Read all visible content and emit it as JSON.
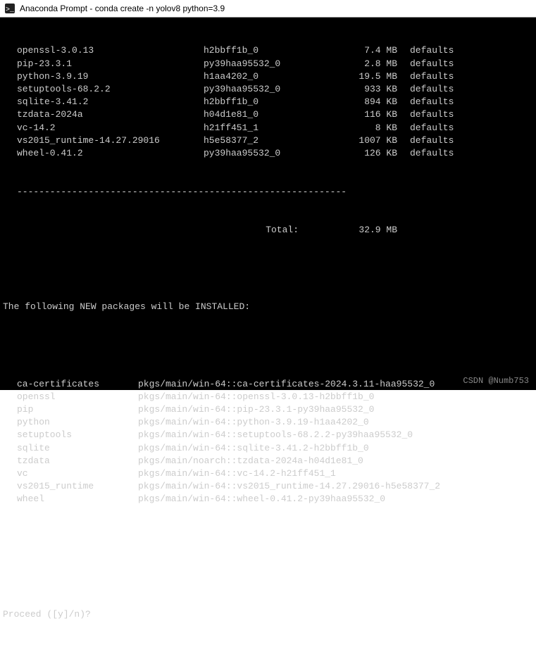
{
  "window": {
    "title": "Anaconda Prompt - conda  create -n yolov8 python=3.9"
  },
  "download_table": [
    {
      "name": "openssl-3.0.13",
      "build": "h2bbff1b_0",
      "size": "7.4 MB",
      "channel": "defaults"
    },
    {
      "name": "pip-23.3.1",
      "build": "py39haa95532_0",
      "size": "2.8 MB",
      "channel": "defaults"
    },
    {
      "name": "python-3.9.19",
      "build": "h1aa4202_0",
      "size": "19.5 MB",
      "channel": "defaults"
    },
    {
      "name": "setuptools-68.2.2",
      "build": "py39haa95532_0",
      "size": "933 KB",
      "channel": "defaults"
    },
    {
      "name": "sqlite-3.41.2",
      "build": "h2bbff1b_0",
      "size": "894 KB",
      "channel": "defaults"
    },
    {
      "name": "tzdata-2024a",
      "build": "h04d1e81_0",
      "size": "116 KB",
      "channel": "defaults"
    },
    {
      "name": "vc-14.2",
      "build": "h21ff451_1",
      "size": "8 KB",
      "channel": "defaults"
    },
    {
      "name": "vs2015_runtime-14.27.29016",
      "build": "h5e58377_2",
      "size": "1007 KB",
      "channel": "defaults"
    },
    {
      "name": "wheel-0.41.2",
      "build": "py39haa95532_0",
      "size": "126 KB",
      "channel": "defaults"
    }
  ],
  "separator": "------------------------------------------------------------",
  "total": {
    "label": "Total:",
    "value": "32.9 MB"
  },
  "install_heading": "The following NEW packages will be INSTALLED:",
  "install_list": [
    {
      "name": "ca-certificates",
      "spec": "pkgs/main/win-64::ca-certificates-2024.3.11-haa95532_0"
    },
    {
      "name": "openssl",
      "spec": "pkgs/main/win-64::openssl-3.0.13-h2bbff1b_0"
    },
    {
      "name": "pip",
      "spec": "pkgs/main/win-64::pip-23.3.1-py39haa95532_0"
    },
    {
      "name": "python",
      "spec": "pkgs/main/win-64::python-3.9.19-h1aa4202_0"
    },
    {
      "name": "setuptools",
      "spec": "pkgs/main/win-64::setuptools-68.2.2-py39haa95532_0"
    },
    {
      "name": "sqlite",
      "spec": "pkgs/main/win-64::sqlite-3.41.2-h2bbff1b_0"
    },
    {
      "name": "tzdata",
      "spec": "pkgs/main/noarch::tzdata-2024a-h04d1e81_0"
    },
    {
      "name": "vc",
      "spec": "pkgs/main/win-64::vc-14.2-h21ff451_1"
    },
    {
      "name": "vs2015_runtime",
      "spec": "pkgs/main/win-64::vs2015_runtime-14.27.29016-h5e58377_2"
    },
    {
      "name": "wheel",
      "spec": "pkgs/main/win-64::wheel-0.41.2-py39haa95532_0"
    }
  ],
  "prompt": "Proceed ([y]/n)?",
  "watermark": "CSDN @Numb753"
}
